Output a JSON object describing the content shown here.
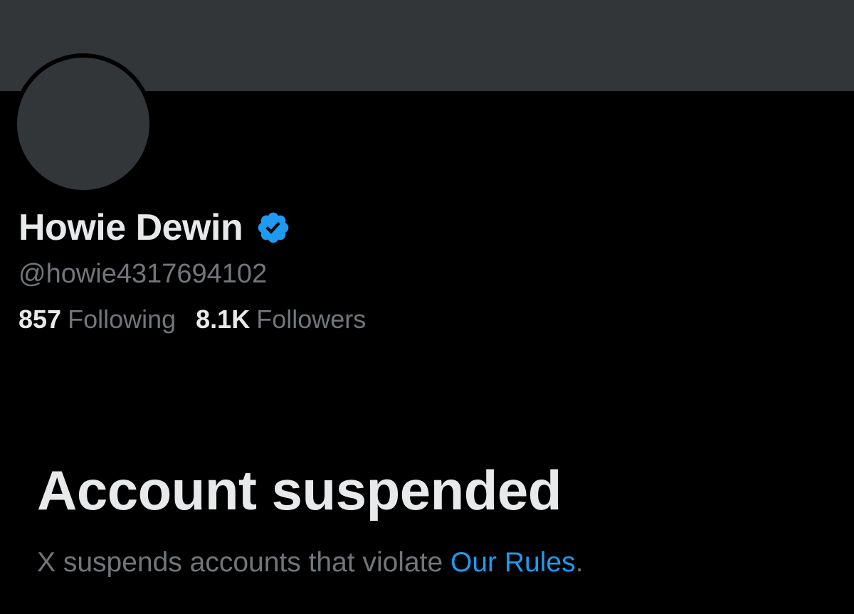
{
  "profile": {
    "display_name": "Howie Dewin",
    "handle": "@howie4317694102",
    "verified_icon": "verified-badge-icon",
    "following_count": "857",
    "following_label": "Following",
    "followers_count": "8.1K",
    "followers_label": "Followers"
  },
  "suspension": {
    "title": "Account suspended",
    "description_prefix": "X suspends accounts that violate ",
    "rules_link": "Our Rules",
    "description_suffix": "."
  },
  "colors": {
    "background": "#000000",
    "banner": "#333639",
    "primary_text": "#e7e9ea",
    "secondary_text": "#71767b",
    "link": "#1d9bf0"
  }
}
